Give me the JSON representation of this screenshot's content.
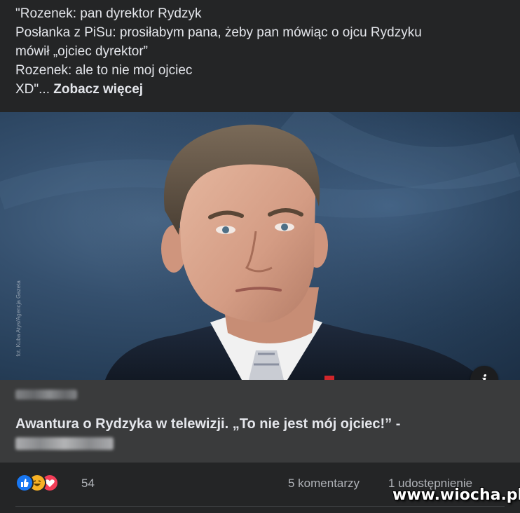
{
  "post": {
    "text_lines": [
      "\"Rozenek: pan dyrektor Rydzyk",
      "Posłanka z PiSu: prosiłabym pana, żeby pan mówiąc o ojcu Rydzyku",
      "mówił „ojciec dyrektor”",
      "Rozenek: ale to nie moj ojciec",
      "XD\"..."
    ],
    "see_more_label": "Zobacz więcej"
  },
  "link_card": {
    "photo_credit": "fot. Kuba Atys/Agencja Gazeta",
    "info_icon": "info-icon",
    "title": "Awantura o Rydzyka w telewizji. „To nie jest mój ojciec!” -"
  },
  "stats": {
    "reaction_icons": [
      "like-reaction-icon",
      "haha-reaction-icon",
      "love-reaction-icon"
    ],
    "reaction_count": "54",
    "comments_label": "5 komentarzy",
    "shares_label": "1 udostępnienie"
  },
  "watermark": "www.wiocha.pl",
  "colors": {
    "background": "#242526",
    "card_body": "#3a3b3c",
    "text_primary": "#e4e6eb",
    "text_secondary": "#b0b3b8",
    "like_blue": "#1877f2",
    "haha_yellow": "#f7b125",
    "love_red": "#f33e58"
  }
}
